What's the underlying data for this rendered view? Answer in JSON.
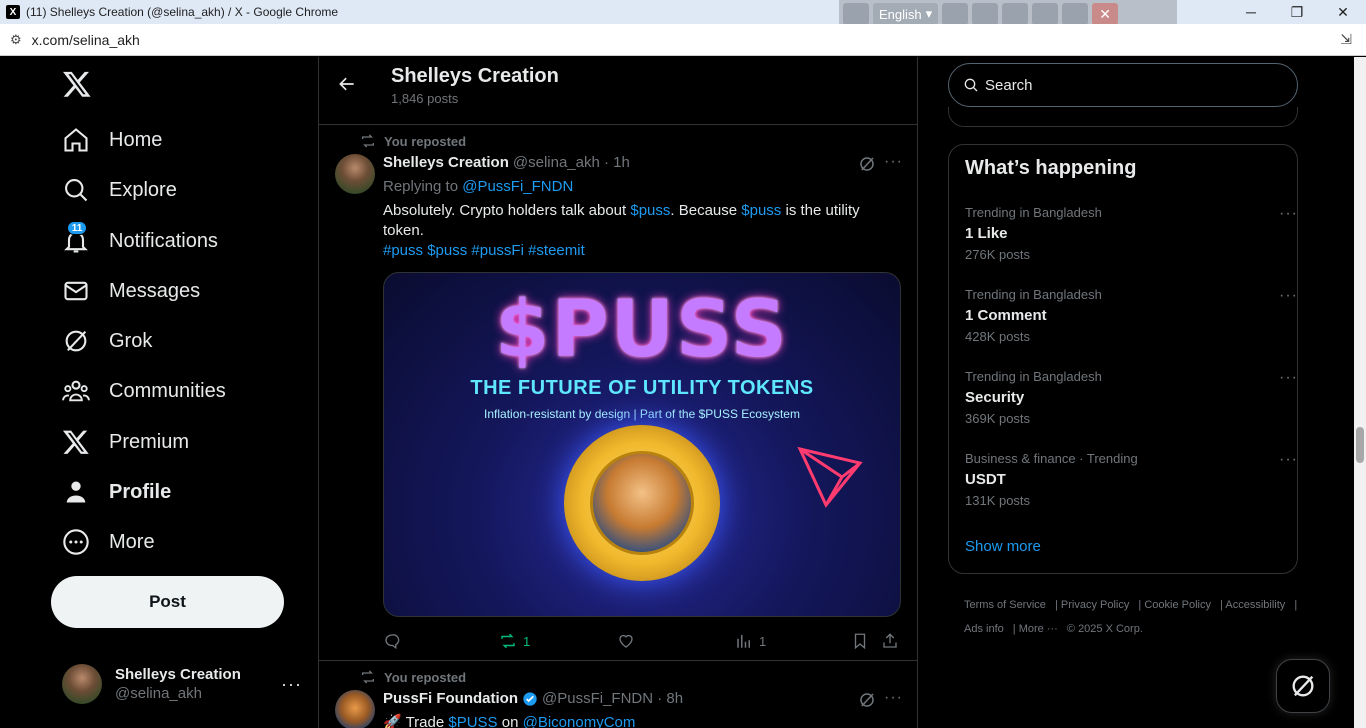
{
  "browser": {
    "window_title": "(11) Shelleys Creation (@selina_akh) / X - Google Chrome",
    "url": "x.com/selina_akh",
    "language": "English",
    "controls": {
      "minimize": "─",
      "restore": "❐",
      "close": "✕"
    }
  },
  "nav": {
    "items": [
      {
        "label": "Home",
        "icon": "home-icon"
      },
      {
        "label": "Explore",
        "icon": "search-icon"
      },
      {
        "label": "Notifications",
        "icon": "bell-icon",
        "badge": "11"
      },
      {
        "label": "Messages",
        "icon": "envelope-icon"
      },
      {
        "label": "Grok",
        "icon": "grok-icon"
      },
      {
        "label": "Communities",
        "icon": "people-icon"
      },
      {
        "label": "Premium",
        "icon": "x-icon"
      },
      {
        "label": "Profile",
        "icon": "person-icon"
      },
      {
        "label": "More",
        "icon": "more-circle-icon"
      }
    ],
    "post_button": "Post",
    "account": {
      "name": "Shelleys Creation",
      "handle": "@selina_akh"
    }
  },
  "header": {
    "title": "Shelleys Creation",
    "posts": "1,846 posts"
  },
  "tweets": [
    {
      "repost_label": "You reposted",
      "name": "Shelleys Creation",
      "handle": "@selina_akh · 1h",
      "replying_label": "Replying to",
      "replying_to": "@PussFi_FNDN",
      "text_1": "Absolutely. Crypto holders talk about ",
      "cashtag_1": "$puss",
      "text_2": ". Because ",
      "cashtag_2": "$puss",
      "text_3": " is the utility token.",
      "hashtags": "#puss $puss #pussFi #steemit",
      "media": {
        "headline": "$PUSS",
        "subhead": "THE FUTURE OF UTILITY TOKENS",
        "tagline": "Inflation-resistant by design | Part of the $PUSS Ecosystem"
      },
      "reposts": "1",
      "views": "1"
    },
    {
      "repost_label": "You reposted",
      "name": "PussFi Foundation",
      "handle": "@PussFi_FNDN · 8h",
      "text_1": "🚀 Trade ",
      "cashtag_1": "$PUSS",
      "text_2": " on ",
      "mention": "@BiconomyCom"
    }
  ],
  "search": {
    "placeholder": "Search"
  },
  "trends": {
    "title": "What’s happening",
    "items": [
      {
        "context": "Trending in Bangladesh",
        "title": "1 Like",
        "posts": "276K posts"
      },
      {
        "context": "Trending in Bangladesh",
        "title": "1 Comment",
        "posts": "428K posts"
      },
      {
        "context": "Trending in Bangladesh",
        "title": "Security",
        "posts": "369K posts"
      },
      {
        "context": "Business & finance · Trending",
        "title": "USDT",
        "posts": "131K posts"
      }
    ],
    "show_more": "Show more"
  },
  "footer": {
    "terms": "Terms of Service",
    "privacy": "Privacy Policy",
    "cookie": "Cookie Policy",
    "accessibility": "Accessibility",
    "ads": "Ads info",
    "more": "More ···",
    "copyright": "© 2025 X Corp."
  }
}
